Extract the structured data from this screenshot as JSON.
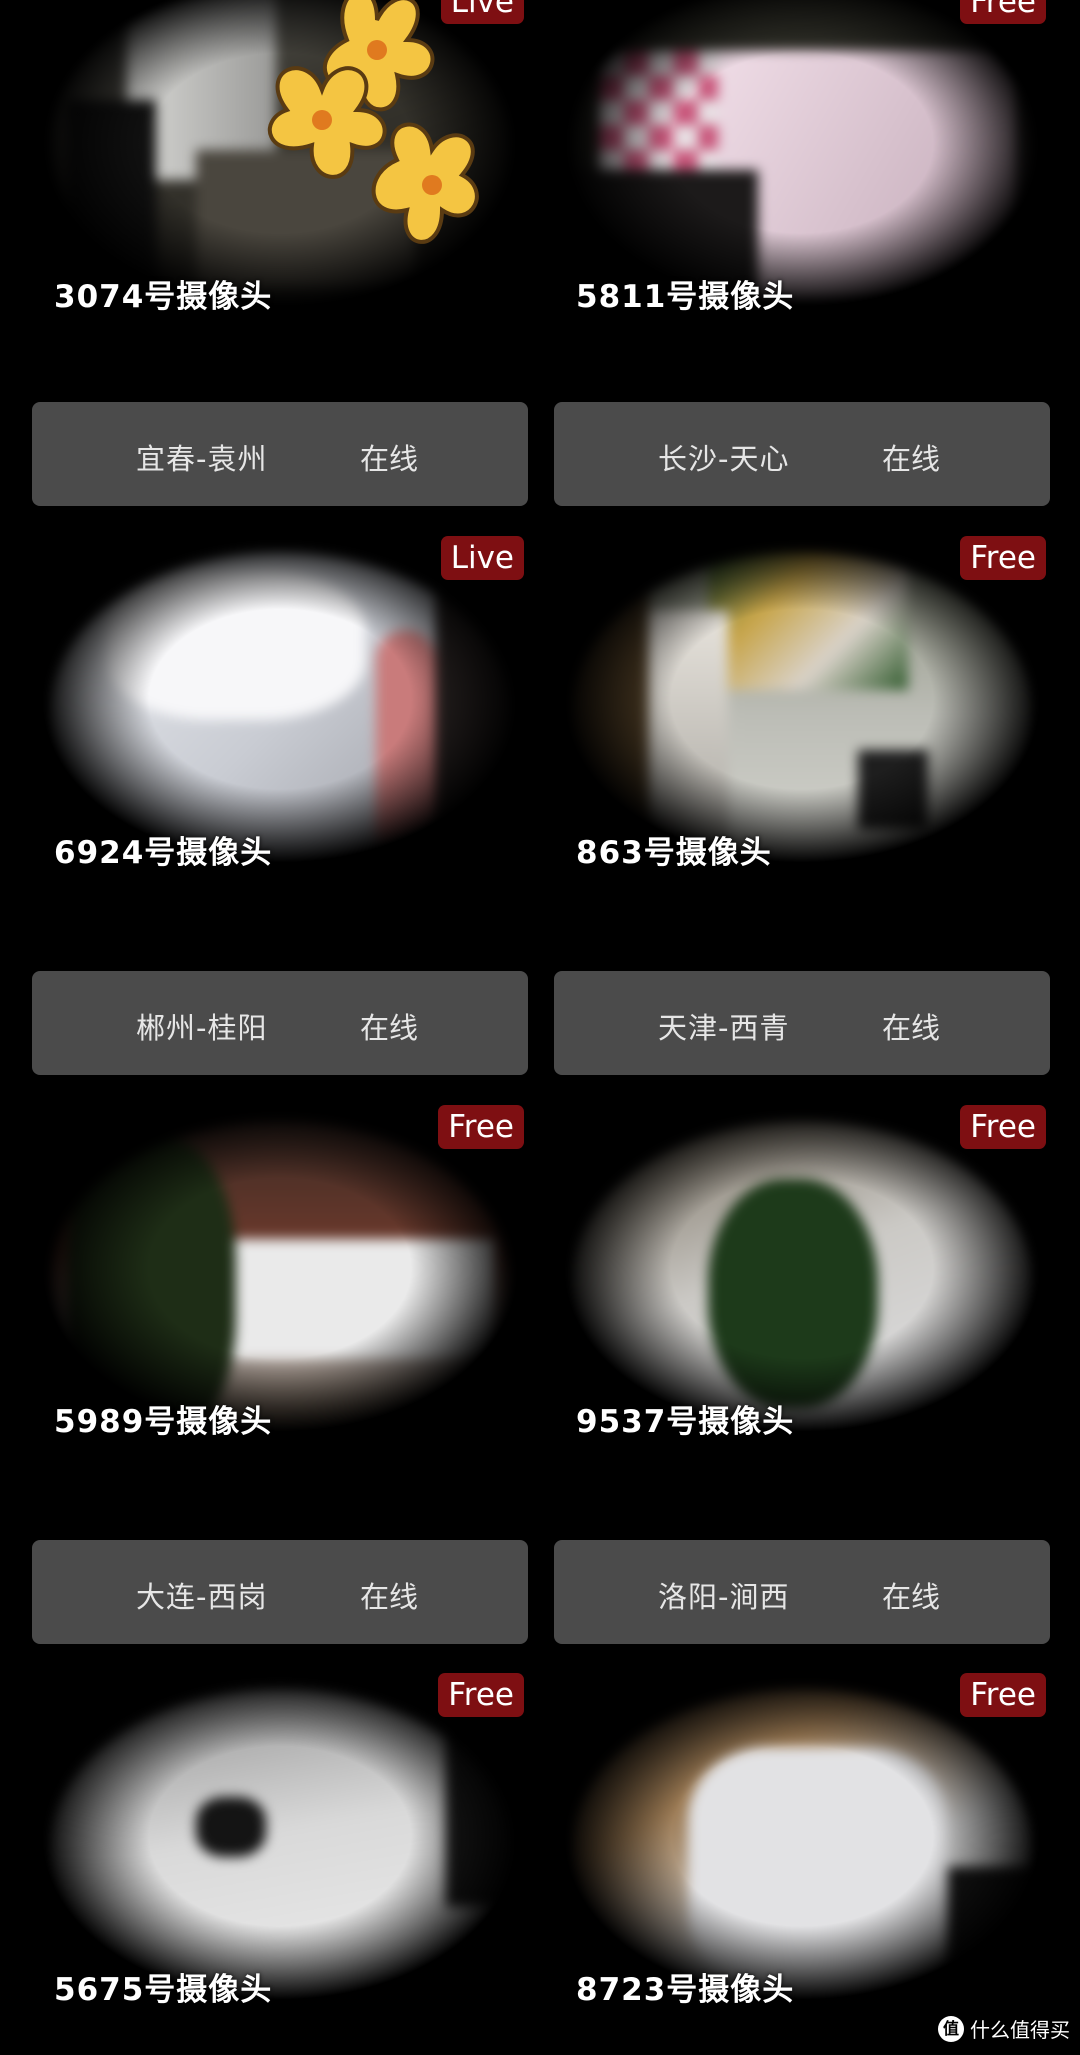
{
  "rows": [
    {
      "cams": [
        {
          "label": "3074号摄像头",
          "badge": "Live"
        },
        {
          "label": "5811号摄像头",
          "badge": "Free"
        }
      ],
      "infos": [
        {
          "location": "宜春-袁州",
          "status": "在线"
        },
        {
          "location": "长沙-天心",
          "status": "在线"
        }
      ]
    },
    {
      "cams": [
        {
          "label": "6924号摄像头",
          "badge": "Live"
        },
        {
          "label": "863号摄像头",
          "badge": "Free"
        }
      ],
      "infos": [
        {
          "location": "郴州-桂阳",
          "status": "在线"
        },
        {
          "location": "天津-西青",
          "status": "在线"
        }
      ]
    },
    {
      "cams": [
        {
          "label": "5989号摄像头",
          "badge": "Free"
        },
        {
          "label": "9537号摄像头",
          "badge": "Free"
        }
      ],
      "infos": [
        {
          "location": "大连-西岗",
          "status": "在线"
        },
        {
          "location": "洛阳-涧西",
          "status": "在线"
        }
      ]
    },
    {
      "cams": [
        {
          "label": "5675号摄像头",
          "badge": "Free"
        },
        {
          "label": "8723号摄像头",
          "badge": "Free"
        }
      ]
    }
  ],
  "watermark": {
    "icon": "值",
    "text": "什么值得买"
  },
  "colors": {
    "badge": "#7e0f12",
    "info_bar": "#4b4b4b",
    "background": "#000000"
  }
}
